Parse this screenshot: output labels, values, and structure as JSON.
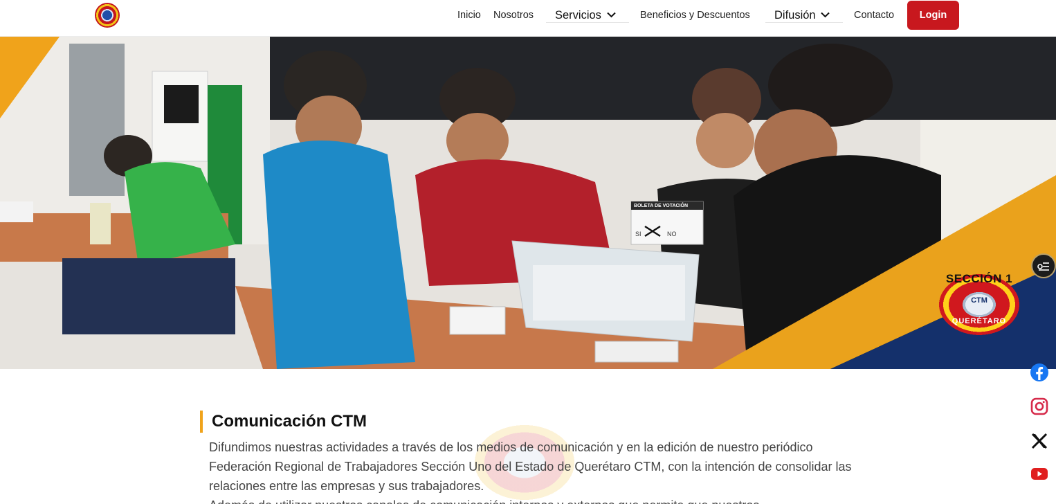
{
  "nav": {
    "items": [
      "Inicio",
      "Nosotros",
      "Servicios",
      "Beneficios y Descuentos",
      "Difusión",
      "Contacto"
    ],
    "login_label": "Login"
  },
  "hero": {
    "ballot_heading": "BOLETA DE VOTACIÓN",
    "ballot_yes": "SI",
    "ballot_no": "NO",
    "seal_top": "SECCIÓN 1",
    "seal_middle": "CTM",
    "seal_bottom": "QUERÉTARO"
  },
  "section": {
    "title": "Comunicación CTM",
    "paragraph": "Difundimos nuestras actividades a través de los medios de comunicación y en la edición de nuestro periódico Federación Regional de Trabajadores Sección Uno del Estado de Querétaro CTM, con la intención de consolidar las relaciones entre las empresas y sus trabajadores.",
    "paragraph2": "Además de utilizar nuestros canales de comunicación internos y externos que permite que nuestros"
  },
  "social": [
    "facebook-icon",
    "instagram-icon",
    "x-icon",
    "youtube-icon"
  ],
  "colors": {
    "accent_red": "#c8181e",
    "accent_orange": "#f0a31b",
    "navy": "#14306b"
  }
}
